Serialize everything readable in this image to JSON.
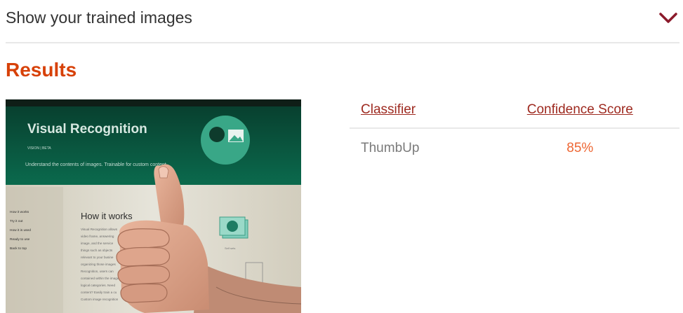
{
  "accordion": {
    "title": "Show your trained images",
    "icon": "chevron-down-icon",
    "icon_color": "#8b1a2b"
  },
  "results": {
    "heading": "Results",
    "heading_color": "#d74108"
  },
  "photo": {
    "screen_title": "Visual Recognition",
    "screen_badge": "VISION | BETA",
    "screen_tagline": "Understand the contents of images. Trainable for custom content.",
    "nav_items": [
      "How it works",
      "Try it out",
      "How it is used",
      "Ready to use",
      "Back to top"
    ],
    "section_title": "How it works",
    "body_lines": [
      "Visual Recognition allows",
      "video frame, answering",
      "image, and the service",
      "things such as objects",
      "relevant to your busine",
      "organizing those images",
      "Recognition, users can",
      "contained within the image",
      "logical categories. Need",
      "content? Easily train a cu",
      "Custom image recognition"
    ],
    "icon_caption": "Self sets"
  },
  "table": {
    "headers": {
      "classifier": "Classifier",
      "score": "Confidence Score"
    },
    "rows": [
      {
        "classifier": "ThumbUp",
        "score": "85%"
      }
    ],
    "header_color": "#9e2a20",
    "score_color": "#ee6633"
  }
}
